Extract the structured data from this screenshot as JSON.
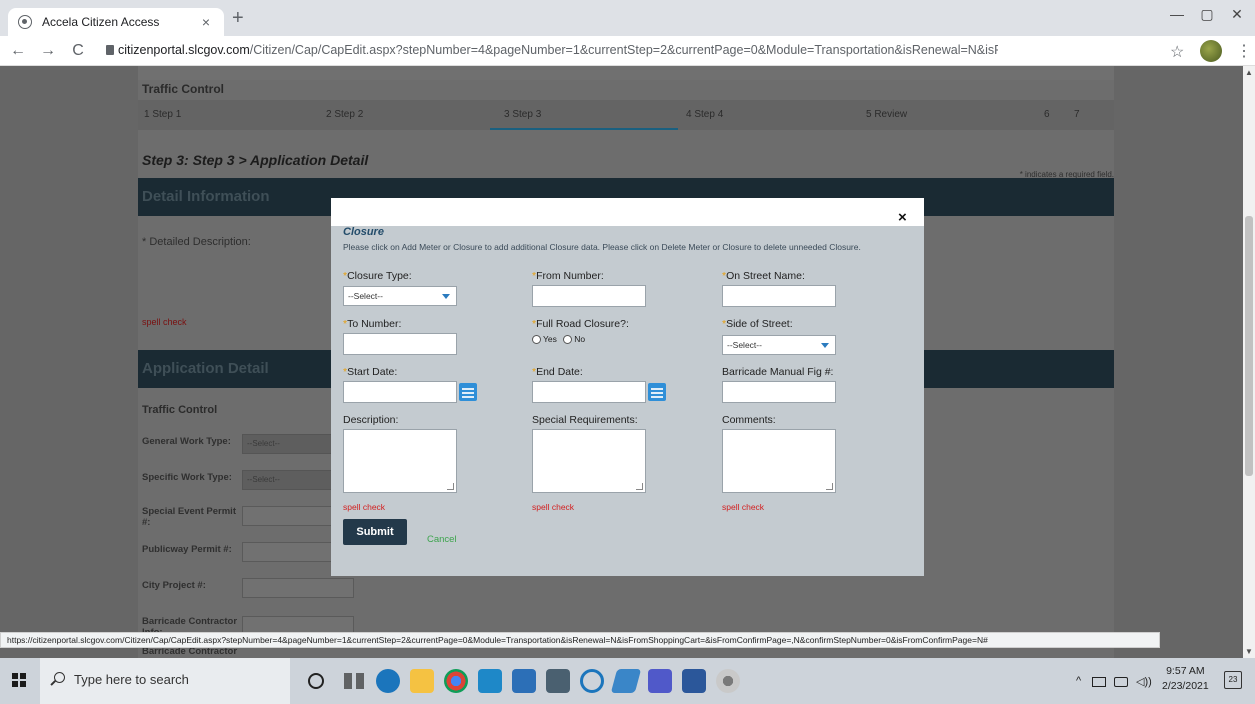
{
  "browser": {
    "tab_title": "Accela Citizen Access",
    "tab_close": "×",
    "new_tab": "+",
    "minimize": "—",
    "maximize": "▢",
    "close": "✕",
    "back": "←",
    "forward": "→",
    "reload": "C",
    "url_host": "citizenportal.slcgov.com",
    "url_path": "/Citizen/Cap/CapEdit.aspx?stepNumber=4&pageNumber=1&currentStep=2&currentPage=0&Module=Transportation&isRenewal=N&isFromShoppingCart=&isFromConfirmPage=,...",
    "bookmark": "☆",
    "menu": "⋮"
  },
  "page": {
    "section_title": "Traffic Control",
    "steps": [
      "1  Step 1",
      "2  Step 2",
      "3  Step 3",
      "4  Step 4",
      "5  Review",
      "6",
      "7"
    ],
    "step_heading": "Step 3: Step 3 > Application Detail",
    "required_note": "* indicates a required field.",
    "detail_banner": "Detail Information",
    "detailed_description": "* Detailed Description:",
    "spell_check": "spell check",
    "application_banner": "Application Detail",
    "traffic_control_2": "Traffic Control",
    "general_work_type": "General Work Type:",
    "specific_work_type": "Specific Work Type:",
    "select_placeholder": "--Select--",
    "special_event_permit": "Special Event Permit #:",
    "publicway_permit": "Publicway Permit #:",
    "city_project": "City Project #:",
    "barricade_contractor_info": "Barricade Contractor Info:",
    "barricade_contractor": "Barricade Contractor"
  },
  "modal": {
    "close": "×",
    "title": "Closure",
    "instructions": "Please click on Add Meter or Closure to add additional Closure data. Please click on Delete Meter or Closure to delete unneeded Closure.",
    "required_mark": "*",
    "closure_type": "Closure Type:",
    "from_number": "From Number:",
    "on_street_name": "On Street Name:",
    "to_number": "To Number:",
    "full_road_closure": "Full Road Closure?:",
    "yes": "Yes",
    "no": "No",
    "side_of_street": "Side of Street:",
    "start_date": "Start Date:",
    "end_date": "End Date:",
    "barricade_manual_fig": "Barricade Manual Fig #:",
    "description": "Description:",
    "special_requirements": "Special Requirements:",
    "comments": "Comments:",
    "select_placeholder": "--Select--",
    "spell_check": "spell check",
    "submit": "Submit",
    "cancel": "Cancel"
  },
  "status_url": "https://citizenportal.slcgov.com/Citizen/Cap/CapEdit.aspx?stepNumber=4&pageNumber=1&currentStep=2&currentPage=0&Module=Transportation&isRenewal=N&isFromShoppingCart=&isFromConfirmPage=,N&confirmStepNumber=0&isFromConfirmPage=N#",
  "taskbar": {
    "search_placeholder": "Type here to search",
    "time": "9:57 AM",
    "date": "2/23/2021",
    "notification_count": "23",
    "tray_chevron": "^"
  },
  "colors": {
    "banner": "#1a2a33",
    "submit": "#23394a",
    "cancel": "#3da44d",
    "spell_check": "#d21f1f",
    "required": "#e8a010"
  }
}
